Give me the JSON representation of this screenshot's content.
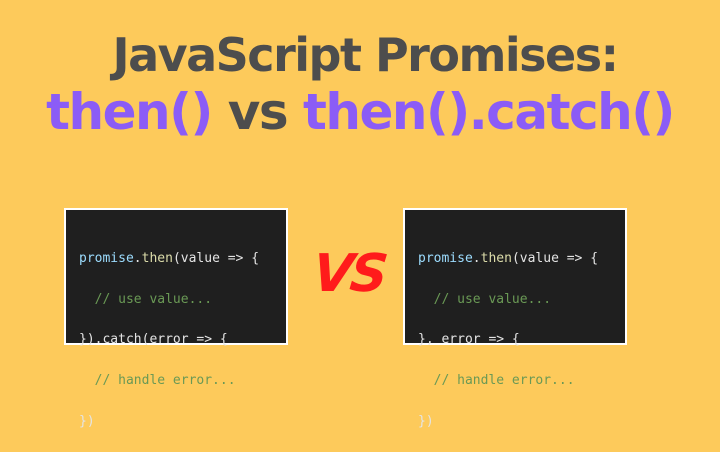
{
  "title": {
    "line1": "JavaScript Promises:",
    "line2_part1": "then()",
    "line2_part2": " vs ",
    "line2_part3": "then().catch()"
  },
  "colors": {
    "background": "#fdca5b",
    "title_gray": "#4d4d4d",
    "accent_purple": "#8b5cf6",
    "vs_red": "#ff1b1b",
    "code_bg": "#1f1f1f",
    "code_comment": "#6a9955",
    "code_identifier": "#9cdcfe"
  },
  "left_code": {
    "line1": {
      "obj": "promise",
      "dot": ".",
      "method": "then",
      "rest": "(value => {"
    },
    "line2": {
      "comment": "  // use value..."
    },
    "line3": {
      "text": "}).catch(error => {"
    },
    "line4": {
      "comment": "  // handle error..."
    },
    "line5": {
      "text": "})"
    }
  },
  "vs_label": "VS",
  "right_code": {
    "line1": {
      "obj": "promise",
      "dot": ".",
      "method": "then",
      "rest": "(value => {"
    },
    "line2": {
      "comment": "  // use value..."
    },
    "line3": {
      "text": "}, error => {"
    },
    "line4": {
      "comment": "  // handle error..."
    },
    "line5": {
      "text": "})"
    }
  }
}
